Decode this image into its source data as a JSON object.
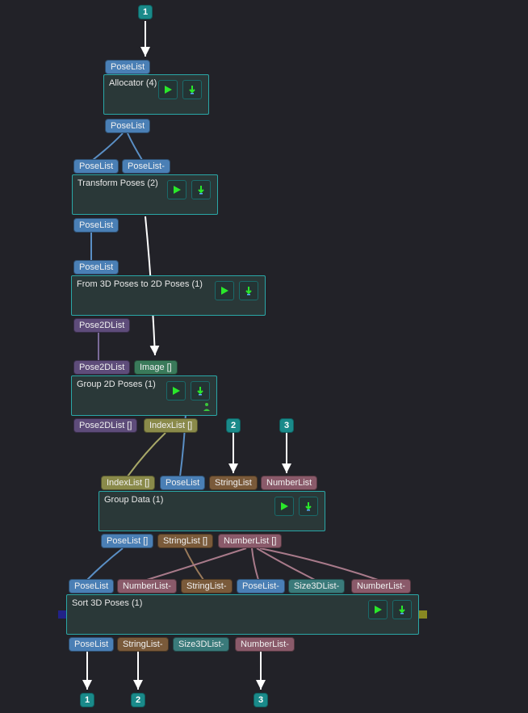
{
  "inputs": [
    "1",
    "2",
    "3"
  ],
  "outputs": [
    "1",
    "2",
    "3"
  ],
  "nodes": {
    "allocator": {
      "title": "Allocator (4)",
      "in": [
        "PoseList"
      ],
      "out": [
        "PoseList"
      ]
    },
    "transform": {
      "title": "Transform Poses (2)",
      "in": [
        "PoseList",
        "PoseList-"
      ],
      "out": [
        "PoseList"
      ]
    },
    "from3d": {
      "title": "From 3D Poses to 2D Poses (1)",
      "in": [
        "PoseList"
      ],
      "out": [
        "Pose2DList"
      ]
    },
    "group2d": {
      "title": "Group 2D Poses (1)",
      "in": [
        "Pose2DList",
        "Image []"
      ],
      "out": [
        "Pose2DList []",
        "IndexList []"
      ]
    },
    "groupdata": {
      "title": "Group Data (1)",
      "in": [
        "IndexList []",
        "PoseList",
        "StringList",
        "NumberList"
      ],
      "out": [
        "PoseList []",
        "StringList []",
        "NumberList []"
      ]
    },
    "sort": {
      "title": "Sort 3D Poses (1)",
      "in": [
        "PoseList",
        "NumberList-",
        "StringList-",
        "PoseList-",
        "Size3DList-",
        "NumberList-"
      ],
      "out": [
        "PoseList",
        "StringList-",
        "Size3DList-",
        "NumberList-"
      ]
    }
  },
  "port_colors": {
    "PoseList": "#4a7fb5",
    "Pose2DList": "#5e4c7a",
    "IndexList": "#8a8a4a",
    "Image": "#3a7a5a",
    "StringList": "#7a5a3a",
    "NumberList": "#8a5a6a",
    "Size3DList": "#3a7a7a"
  }
}
